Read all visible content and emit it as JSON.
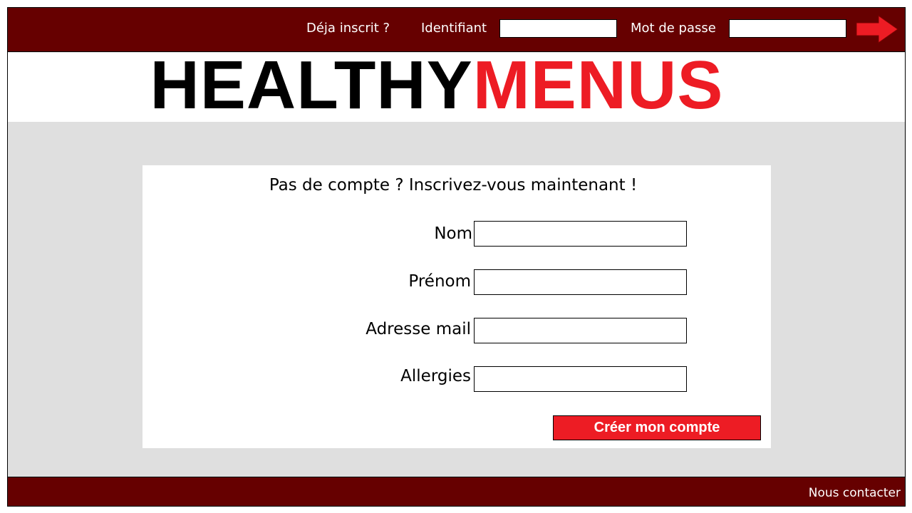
{
  "colors": {
    "bar": "#660000",
    "accent": "#ed1c24",
    "background": "#dfdfdf"
  },
  "header": {
    "already_registered": "Déja inscrit ?",
    "login_label": "Identifiant",
    "login_value": "",
    "password_label": "Mot de passe",
    "password_value": "",
    "submit_icon": "arrow-right-icon"
  },
  "logo": {
    "word1": "HEALTHY",
    "word2": "MENUS"
  },
  "signup": {
    "title": "Pas de compte ? Inscrivez-vous maintenant !",
    "fields": [
      {
        "label": "Nom",
        "value": ""
      },
      {
        "label": "Prénom",
        "value": ""
      },
      {
        "label": "Adresse mail",
        "value": ""
      },
      {
        "label": "Allergies",
        "value": ""
      }
    ],
    "submit_label": "Créer mon compte"
  },
  "footer": {
    "contact": "Nous contacter"
  }
}
